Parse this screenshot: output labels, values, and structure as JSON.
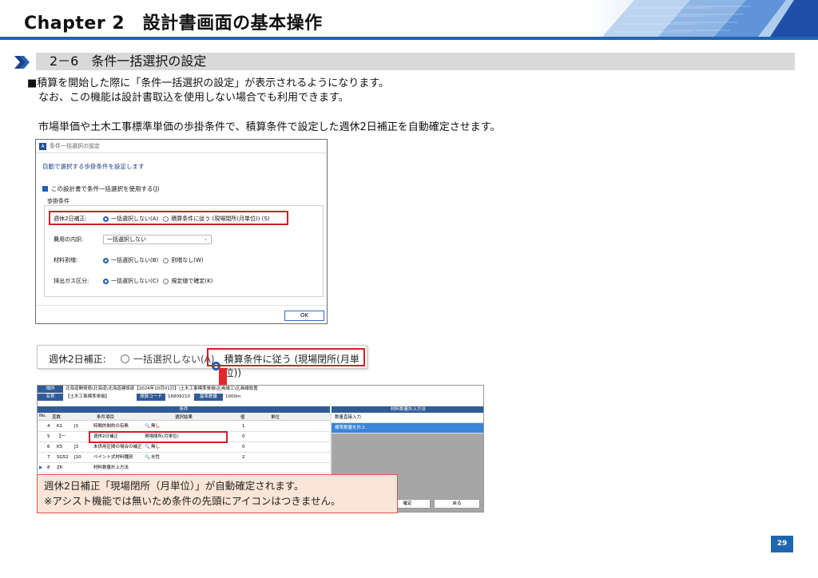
{
  "header": {
    "chapter_title": "Chapter 2　設計書画面の基本操作"
  },
  "section": {
    "title": "2－6　条件一括選択の設定"
  },
  "body": {
    "line1": "■積算を開始した際に「条件一括選択の設定」が表示されるようになります。",
    "line2": "なお、この機能は設計書取込を使用しない場合でも利用できます。",
    "line3": "市場単価や土木工事標準単価の歩掛条件で、積算条件で設定した週休2日補正を自動確定させます。"
  },
  "dialog": {
    "app_icon": "A",
    "title": "条件一括選択の設定",
    "heading": "自動で選択する歩掛条件を設定します",
    "checkbox_label": "この設計書で条件一括選択を使用する(J)",
    "group_label": "歩掛条件",
    "rows": [
      {
        "label": "週休2日補正:",
        "options": [
          "一括選択しない(A)",
          "積算条件に従う (現場閉所(月単位)) (S)"
        ]
      },
      {
        "label": "費用の内訳:",
        "select_value": "一括選択しない"
      },
      {
        "label": "材料割増:",
        "options": [
          "一括選択しない(B)",
          "割増なし(W)"
        ]
      },
      {
        "label": "排出ガス区分:",
        "options": [
          "一括選択しない(C)",
          "規定値で確定(K)"
        ]
      }
    ],
    "ok_label": "OK"
  },
  "zoom": {
    "label": "週休2日補正:",
    "option_off": "一括選択しない(A)",
    "option_on": "積算条件に従う (現場閉所(月単位))"
  },
  "grid": {
    "info": [
      {
        "key": "場所",
        "value": "北海道開発局\\北海道\\北海道建設部【2024年10月01日】\\土木工事標準単価\\区画線工\\区画線設置"
      },
      {
        "key": "名称",
        "value": "【土木工事標準単価】",
        "key2": "積算コード",
        "value2": "16809210",
        "key3": "基準数量",
        "value3": "1000m"
      }
    ],
    "table_title": "条件",
    "columns": [
      "No.",
      "変数",
      "条件項目",
      "選択結果",
      "値",
      "単位"
    ],
    "rows": [
      {
        "no": "4",
        "var": "K1",
        "var2": "J1",
        "item": "時間的制約の有無",
        "result": "無し",
        "value": "1",
        "unit": ""
      },
      {
        "no": "5",
        "var": "【一",
        "var2": "",
        "item": "週休2日補正",
        "result": "現場閉所(月単位)",
        "value": "0",
        "unit": ""
      },
      {
        "no": "6",
        "var": "K5",
        "var2": "J3",
        "item": "未供用区間の場合の補正",
        "result": "無し",
        "value": "0",
        "unit": ""
      },
      {
        "no": "7",
        "var": "SG52",
        "var2": "J10",
        "item": "ペイント式材料種別",
        "result": "水性",
        "value": "2",
        "unit": ""
      },
      {
        "no": "8",
        "var": "ZK",
        "var2": "",
        "item": "材料数量計上方法",
        "result": "",
        "value": "",
        "unit": ""
      }
    ],
    "right_panel_title": "材料数量計上方法",
    "right_panel_items": [
      "数量直接入力",
      "標準数量を計上"
    ],
    "confirm_label": "確定",
    "back_label": "戻る"
  },
  "callout": {
    "line1": "週休2日補正「現場閉所（月単位）」が自動確定されます。",
    "line2": "※アシスト機能では無いため条件の先頭にアイコンはつきません。"
  },
  "page_number": "29",
  "colors": {
    "brand_blue": "#1f66b0",
    "highlight_red": "#d01f26",
    "callout_bg": "#fbe5d6"
  }
}
